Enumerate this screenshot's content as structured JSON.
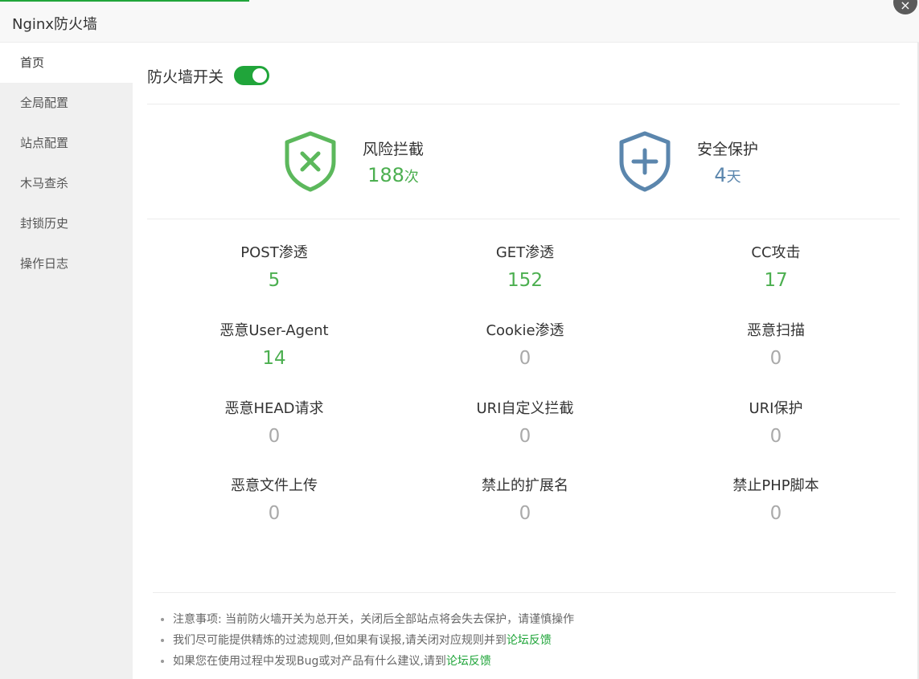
{
  "window": {
    "title": "Nginx防火墙",
    "close_icon": "×"
  },
  "sidebar": {
    "items": [
      {
        "label": "首页",
        "active": true
      },
      {
        "label": "全局配置"
      },
      {
        "label": "站点配置"
      },
      {
        "label": "木马查杀"
      },
      {
        "label": "封锁历史"
      },
      {
        "label": "操作日志"
      }
    ]
  },
  "firewall_switch": {
    "label": "防火墙开关",
    "enabled": true
  },
  "summary": {
    "risk": {
      "label": "风险拦截",
      "value": "188",
      "unit": "次",
      "icon": "shield-x-icon",
      "color": "#5cb85c"
    },
    "protect": {
      "label": "安全保护",
      "value": "4",
      "unit": "天",
      "icon": "shield-plus-icon",
      "color": "#5b86ad"
    }
  },
  "stats": [
    {
      "label": "POST渗透",
      "value": "5"
    },
    {
      "label": "GET渗透",
      "value": "152"
    },
    {
      "label": "CC攻击",
      "value": "17"
    },
    {
      "label": "恶意User-Agent",
      "value": "14"
    },
    {
      "label": "Cookie渗透",
      "value": "0"
    },
    {
      "label": "恶意扫描",
      "value": "0"
    },
    {
      "label": "恶意HEAD请求",
      "value": "0"
    },
    {
      "label": "URI自定义拦截",
      "value": "0"
    },
    {
      "label": "URI保护",
      "value": "0"
    },
    {
      "label": "恶意文件上传",
      "value": "0"
    },
    {
      "label": "禁止的扩展名",
      "value": "0"
    },
    {
      "label": "禁止PHP脚本",
      "value": "0"
    }
  ],
  "notes": {
    "n1": "注意事项: 当前防火墙开关为总开关，关闭后全部站点将会失去保护，请谨慎操作",
    "n2": "我们尽可能提供精炼的过滤规则,但如果有误报,请关闭对应规则并到",
    "n2_link": "论坛反馈",
    "n3": "如果您在使用过程中发现Bug或对产品有什么建议,请到",
    "n3_link": "论坛反馈"
  }
}
